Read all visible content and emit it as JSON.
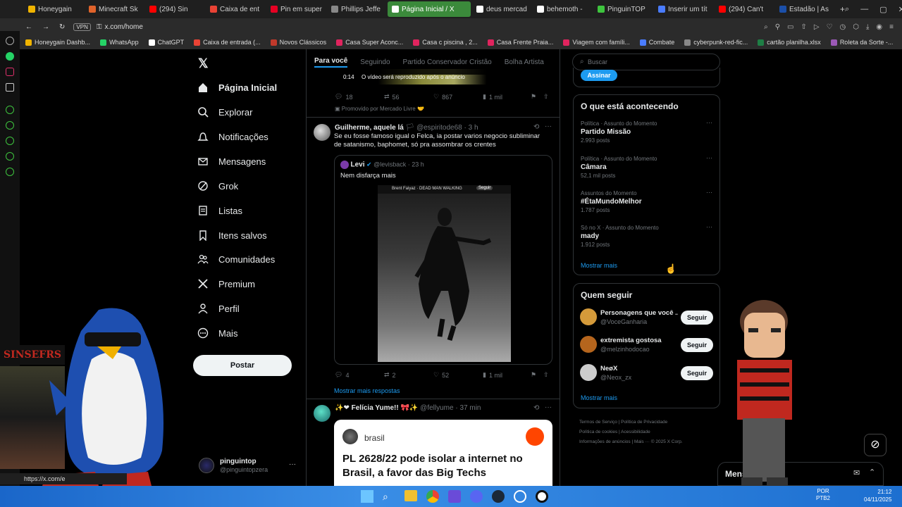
{
  "browser": {
    "tabs": [
      {
        "label": "Honeygain",
        "color": "#f0b400"
      },
      {
        "label": "Minecraft Sk",
        "color": "#e0632b"
      },
      {
        "label": "(294) Sin",
        "color": "#ff0000"
      },
      {
        "label": "Caixa de ent",
        "color": "#ea4335"
      },
      {
        "label": "Pin em super",
        "color": "#e60023"
      },
      {
        "label": "Phillips Jeffe",
        "color": "#888888"
      },
      {
        "label": "Página Inicial / X",
        "color": "#ffffff"
      },
      {
        "label": "deus mercad",
        "color": "#ffffff"
      },
      {
        "label": "behemoth -",
        "color": "#ffffff"
      },
      {
        "label": "PinguinTOP",
        "color": "#3ec43e"
      },
      {
        "label": "Inserir um tít",
        "color": "#4a7cff"
      },
      {
        "label": "(294) Can't",
        "color": "#ff0000"
      },
      {
        "label": "Estadão | As",
        "color": "#1b4fa8"
      }
    ],
    "url": "x.com/home",
    "vpn_label": "VPN",
    "bookmarks": [
      {
        "label": "Honeygain Dashb...",
        "color": "#f0b400"
      },
      {
        "label": "WhatsApp",
        "color": "#25d366"
      },
      {
        "label": "ChatGPT",
        "color": "#ffffff"
      },
      {
        "label": "Caixa de entrada (...",
        "color": "#ea4335"
      },
      {
        "label": "Novos Clássicos",
        "color": "#c0392b"
      },
      {
        "label": "Casa Super Aconc...",
        "color": "#e0245e"
      },
      {
        "label": "Casa c piscina , 2...",
        "color": "#e0245e"
      },
      {
        "label": "Casa Frente Praia...",
        "color": "#e0245e"
      },
      {
        "label": "Viagem com famíli...",
        "color": "#e0245e"
      },
      {
        "label": "Combate",
        "color": "#4a7cff"
      },
      {
        "label": "cyberpunk-red-fic...",
        "color": "#888888"
      },
      {
        "label": "cartão planilha.xlsx",
        "color": "#1e7e45"
      },
      {
        "label": "Roleta da Sorte -...",
        "color": "#9b59b6"
      }
    ]
  },
  "nav": {
    "items": [
      {
        "label": "Página Inicial",
        "icon": "home-icon"
      },
      {
        "label": "Explorar",
        "icon": "search-icon"
      },
      {
        "label": "Notificações",
        "icon": "bell-icon"
      },
      {
        "label": "Mensagens",
        "icon": "mail-icon"
      },
      {
        "label": "Grok",
        "icon": "grok-icon"
      },
      {
        "label": "Listas",
        "icon": "list-icon"
      },
      {
        "label": "Itens salvos",
        "icon": "bookmark-icon"
      },
      {
        "label": "Comunidades",
        "icon": "people-icon"
      },
      {
        "label": "Premium",
        "icon": "x-logo-icon"
      },
      {
        "label": "Perfil",
        "icon": "person-icon"
      },
      {
        "label": "Mais",
        "icon": "more-icon"
      }
    ],
    "post_label": "Postar",
    "account": {
      "name": "pinguintop",
      "handle": "@pinguintopzera"
    }
  },
  "timeline": {
    "tabs": [
      "Para você",
      "Seguindo",
      "Partido Conservador Cristão",
      "Bolha Artista"
    ],
    "ad": {
      "video_time": "0:14",
      "video_note": "O vídeo será reproduzido após o anúncio",
      "replies": "18",
      "reposts": "56",
      "likes": "867",
      "views": "1 mil",
      "promoted": "Promovido por Mercado Livre"
    },
    "tweet1": {
      "name": "Guilherme, aquele lá",
      "handle": "@espiritode68",
      "time": "3 h",
      "text": "Se eu fosse famoso igual o Felca, ia postar varios negocio subliminar de satanismo, baphomet, só pra assombrar os crentes",
      "quote": {
        "name": "Levi",
        "handle": "@levisback",
        "time": "23 h",
        "text": "Nem disfarça mais",
        "media_caption": "Brent Faiyaz · DEAD MAN WALKING",
        "media_follow": "Seguir"
      },
      "replies": "4",
      "reposts": "2",
      "likes": "52",
      "views": "1 mil"
    },
    "show_more_replies": "Mostrar mais respostas",
    "tweet2": {
      "name": "Felícia Yume!!",
      "handle": "@fellyume",
      "time": "37 min",
      "card_source": "brasil",
      "card_title": "PL 2628/22 pode isolar a internet no Brasil, a favor das Big Techs"
    }
  },
  "right": {
    "search_placeholder": "Buscar",
    "subscribe_label": "Assinar",
    "trends_title": "O que está acontecendo",
    "trends": [
      {
        "context": "Política · Assunto do Momento",
        "title": "Partido Missão",
        "posts": "2.993 posts"
      },
      {
        "context": "Política · Assunto do Momento",
        "title": "Câmara",
        "posts": "52,1 mil posts"
      },
      {
        "context": "Assuntos do Momento",
        "title": "#ÉtaMundoMelhor",
        "posts": "1.787 posts"
      },
      {
        "context": "Só no X · Assunto do Momento",
        "title": "mady",
        "posts": "1.912 posts"
      }
    ],
    "show_more": "Mostrar mais",
    "who_title": "Quem seguir",
    "who": [
      {
        "name": "Personagens que você ...",
        "handle": "@VoceGanharia",
        "color": "#d49a3a"
      },
      {
        "name": "extremista gostosa",
        "handle": "@melzinhodocao",
        "color": "#b5651d"
      },
      {
        "name": "NeøX",
        "handle": "@Neox_zx",
        "color": "#cccccc"
      }
    ],
    "follow_label": "Seguir",
    "footer": [
      "Termos de Serviço",
      "Política de Privacidade",
      "Política de cookies",
      "Acessibilidade",
      "Informações de anúncios",
      "Mais ···",
      "© 2025 X Corp."
    ],
    "messages_label": "Mens"
  },
  "overlay": {
    "status_url": "https://x.com/e",
    "stream_sign": "SINSEFRS"
  },
  "taskbar": {
    "lang": "POR",
    "lang2": "PTB2",
    "time": "21:12",
    "date": "04/11/2025"
  }
}
